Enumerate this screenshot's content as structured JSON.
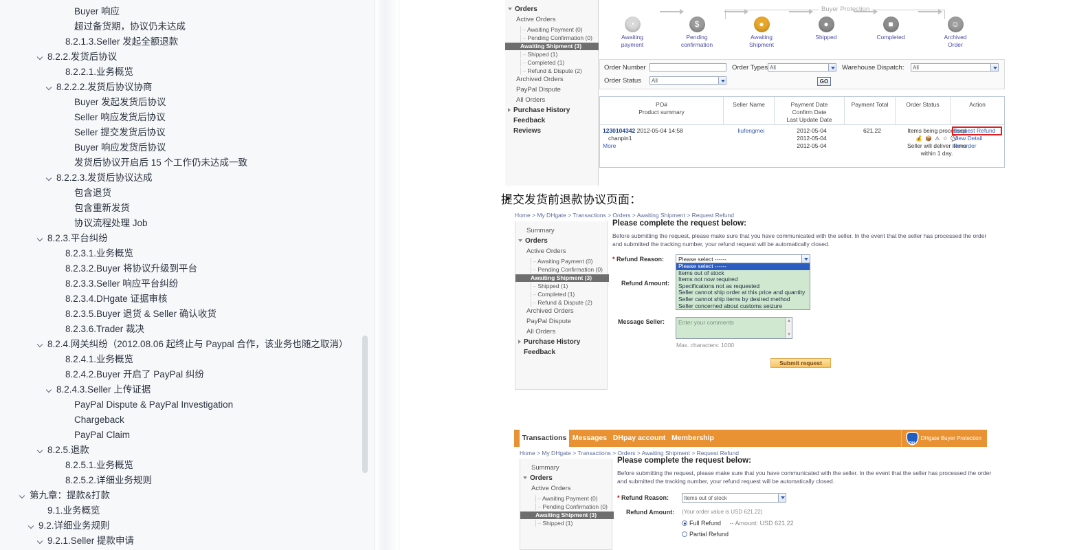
{
  "outline": {
    "items": [
      {
        "label": "Buyer 响应",
        "indent": 6,
        "caret": false
      },
      {
        "label": "超过备货期，协议仍未达成",
        "indent": 6,
        "caret": false
      },
      {
        "label": "8.2.1.3.Seller 发起全额退款",
        "indent": 5,
        "caret": false
      },
      {
        "label": "8.2.2.发货后协议",
        "indent": 3,
        "caret": true
      },
      {
        "label": "8.2.2.1.业务概览",
        "indent": 5,
        "caret": false
      },
      {
        "label": "8.2.2.2.发货后协议协商",
        "indent": 4,
        "caret": true
      },
      {
        "label": "Buyer 发起发货后协议",
        "indent": 6,
        "caret": false
      },
      {
        "label": "Seller 响应发货后协议",
        "indent": 6,
        "caret": false
      },
      {
        "label": "Seller 提交发货后协议",
        "indent": 6,
        "caret": false
      },
      {
        "label": "Buyer 响应发货后协议",
        "indent": 6,
        "caret": false
      },
      {
        "label": "发货后协议开启后 15 个工作仍未达成一致",
        "indent": 6,
        "caret": false
      },
      {
        "label": "8.2.2.3.发货后协议达成",
        "indent": 4,
        "caret": true
      },
      {
        "label": "包含退货",
        "indent": 6,
        "caret": false
      },
      {
        "label": "包含重新发货",
        "indent": 6,
        "caret": false
      },
      {
        "label": "协议流程处理 Job",
        "indent": 6,
        "caret": false
      },
      {
        "label": "8.2.3.平台纠纷",
        "indent": 3,
        "caret": true
      },
      {
        "label": "8.2.3.1.业务概览",
        "indent": 5,
        "caret": false
      },
      {
        "label": "8.2.3.2.Buyer 将协议升级到平台",
        "indent": 5,
        "caret": false
      },
      {
        "label": "8.2.3.3.Seller 响应平台纠纷",
        "indent": 5,
        "caret": false
      },
      {
        "label": "8.2.3.4.DHgate 证据审核",
        "indent": 5,
        "caret": false
      },
      {
        "label": "8.2.3.5.Buyer 退货 & Seller 确认收货",
        "indent": 5,
        "caret": false
      },
      {
        "label": "8.2.3.6.Trader 裁决",
        "indent": 5,
        "caret": false
      },
      {
        "label": "8.2.4.网关纠纷（2012.08.06 起终止与 Paypal 合作，该业务也随之取消）",
        "indent": 3,
        "caret": true
      },
      {
        "label": "8.2.4.1.业务概览",
        "indent": 5,
        "caret": false
      },
      {
        "label": "8.2.4.2.Buyer 开启了 PayPal 纠纷",
        "indent": 5,
        "caret": false
      },
      {
        "label": "8.2.4.3.Seller 上传证据",
        "indent": 4,
        "caret": true
      },
      {
        "label": "PayPal Dispute & PayPal Investigation",
        "indent": 6,
        "caret": false
      },
      {
        "label": "Chargeback",
        "indent": 6,
        "caret": false
      },
      {
        "label": "PayPal Claim",
        "indent": 6,
        "caret": false
      },
      {
        "label": "8.2.5.退款",
        "indent": 3,
        "caret": true
      },
      {
        "label": "8.2.5.1.业务概览",
        "indent": 5,
        "caret": false
      },
      {
        "label": "8.2.5.2.详细业务规则",
        "indent": 5,
        "caret": false
      },
      {
        "label": "第九章：提款&打款",
        "indent": 1,
        "caret": true
      },
      {
        "label": "9.1.业务概览",
        "indent": 3,
        "caret": false
      },
      {
        "label": "9.2.详细业务规则",
        "indent": 2,
        "caret": true
      },
      {
        "label": "9.2.1.Seller 提款申请",
        "indent": 3,
        "caret": true
      }
    ]
  },
  "section_heading": {
    "arrow": "➤",
    "title": "提交发货前退款协议页面："
  },
  "orders_screenshot": {
    "sidebar": {
      "groups": [
        {
          "label": "Orders",
          "type": "group"
        },
        {
          "label": "Active Orders",
          "type": "sub"
        },
        {
          "label": "Awaiting Payment (0)",
          "type": "leaf"
        },
        {
          "label": "Pending Confirmation (0)",
          "type": "leaf"
        },
        {
          "label": "Awaiting Shipment (3)",
          "type": "active"
        },
        {
          "label": "Shipped (1)",
          "type": "leaf"
        },
        {
          "label": "Completed (1)",
          "type": "leaf"
        },
        {
          "label": "Refund & Dispute (2)",
          "type": "leaf"
        },
        {
          "label": "Archived Orders",
          "type": "sub"
        },
        {
          "label": "PayPal Dispute",
          "type": "sub"
        },
        {
          "label": "All Orders",
          "type": "sub"
        },
        {
          "label": "Purchase History",
          "type": "group"
        },
        {
          "label": "Feedback",
          "type": "group"
        },
        {
          "label": "Reviews",
          "type": "group"
        }
      ]
    },
    "flow": {
      "buyer_protection_label": "Buyer Protection",
      "steps": [
        {
          "line1": "Awaiting",
          "line2": "payment",
          "icon": "clock-icon",
          "color": "#d8d8d8"
        },
        {
          "line1": "Pending",
          "line2": "confirmation",
          "icon": "dollar-icon",
          "color": "#9b9b9b"
        },
        {
          "line1": "Awaiting",
          "line2": "Shipment",
          "icon": "package-pay-icon",
          "color": "#e8a72b"
        },
        {
          "line1": "Shipped",
          "line2": "",
          "icon": "shipped-icon",
          "color": "#8e8e8e"
        },
        {
          "line1": "Completed",
          "line2": "",
          "icon": "box-icon",
          "color": "#8e8e8e"
        },
        {
          "line1": "Archived",
          "line2": "Order",
          "icon": "smile-icon",
          "color": "#9c9c9c"
        }
      ]
    },
    "filters": {
      "order_number_label": "Order Number",
      "order_number_value": "",
      "order_types_label": "Order Types:",
      "order_types_value": "All",
      "warehouse_label": "Warehouse Dispatch:",
      "warehouse_value": "All",
      "order_status_label": "Order Status",
      "order_status_value": "All",
      "go_label": "GO"
    },
    "table": {
      "headers": [
        {
          "line1": "PO#",
          "line2": "Product summary",
          "line3": ""
        },
        {
          "line1": "Seller Name",
          "line2": "",
          "line3": ""
        },
        {
          "line1": "Payment Date",
          "line2": "Confirm Date",
          "line3": "Last Update Date"
        },
        {
          "line1": "Payment Total",
          "line2": "",
          "line3": ""
        },
        {
          "line1": "Order Status",
          "line2": "",
          "line3": ""
        },
        {
          "line1": "Action",
          "line2": "",
          "line3": ""
        }
      ],
      "row": {
        "po_number": "1230104342",
        "po_date": "2012-05-04 14:58",
        "product": "chanpin1",
        "more": "More",
        "seller": "liufengmei",
        "payment_date": "2012-05-04",
        "confirm_date": "2012-05-04",
        "last_update_date": "2012-05-04",
        "payment_total": "621.22",
        "status_line1": "Items being processed",
        "status_icons": "💰 📦 ⚠ ☆ 💬",
        "status_line2": "Seller will deliver items",
        "status_line3": "within 1 day.",
        "actions": [
          "Request Refund",
          "View Detail",
          "Re-order"
        ]
      }
    }
  },
  "refund_screenshot": {
    "breadcrumb": "Home > My DHgate > Transactions > Orders > Awaiting Shipment > Request Refund",
    "sidebar": [
      {
        "label": "Summary",
        "type": "sub"
      },
      {
        "label": "Orders",
        "type": "group"
      },
      {
        "label": "Active Orders",
        "type": "sub"
      },
      {
        "label": "Awaiting Payment (0)",
        "type": "leaf"
      },
      {
        "label": "Pending Confirmation (0)",
        "type": "leaf"
      },
      {
        "label": "Awaiting Shipment (3)",
        "type": "active"
      },
      {
        "label": "Shipped (1)",
        "type": "leaf"
      },
      {
        "label": "Completed (1)",
        "type": "leaf"
      },
      {
        "label": "Refund & Dispute (2)",
        "type": "leaf"
      },
      {
        "label": "Archived Orders",
        "type": "sub"
      },
      {
        "label": "PayPal Dispute",
        "type": "sub"
      },
      {
        "label": "All Orders",
        "type": "sub"
      },
      {
        "label": "Purchase History",
        "type": "group"
      },
      {
        "label": "Feedback",
        "type": "group"
      }
    ],
    "heading": "Please complete the request below:",
    "intro": "Before submitting the request, please make sure that you have communicated with the seller. In the event that the seller has processed the order and submitted the tracking number, your refund request will be automatically closed.",
    "refund_reason_label": "Refund Reason:",
    "refund_reason_value": "Please select ------",
    "refund_reason_options": [
      "Please select ------",
      "Items out of stock",
      "Items not now required",
      "Specifications not as requested",
      "Seller cannot ship order at this price and quantity",
      "Seller cannot ship items by desired method",
      "Seller concerned about customs seizure"
    ],
    "refund_amount_label": "Refund Amount:",
    "message_seller_label": "Message Seller:",
    "message_placeholder": "Enter your comments",
    "max_characters": "Max. characters: 1000",
    "submit_label": "Submit request"
  },
  "tabs_screenshot": {
    "tabs": [
      {
        "label": "Transactions",
        "active": true
      },
      {
        "label": "Messages",
        "active": false
      },
      {
        "label": "DHpay account",
        "active": false
      },
      {
        "label": "Membership",
        "active": false
      }
    ],
    "buyer_protection_badge": "DHgate Buyer Protection",
    "breadcrumb": "Home > My DHgate > Transactions > Orders > Awaiting Shipment > Request Refund",
    "sidebar": [
      {
        "label": "Summary",
        "type": "sub"
      },
      {
        "label": "Orders",
        "type": "group"
      },
      {
        "label": "Active Orders",
        "type": "sub"
      },
      {
        "label": "Awaiting Payment (0)",
        "type": "leaf"
      },
      {
        "label": "Pending Confirmation (0)",
        "type": "leaf"
      },
      {
        "label": "Awaiting Shipment (3)",
        "type": "active"
      },
      {
        "label": "Shipped (1)",
        "type": "leaf"
      }
    ],
    "heading": "Please complete the request below:",
    "intro": "Before submitting the request, please make sure that you have communicated with the seller. In the event that the seller has processed the order and submitted the tracking number, your refund request will be automatically closed.",
    "refund_reason_label": "Refund Reason:",
    "refund_reason_value": "Items out of stock",
    "refund_amount_label": "Refund Amount:",
    "order_value_note": "(Your order value is USD 621.22)",
    "full_refund_label": "Full Refund",
    "full_refund_amount": "-- Amount: USD 621.22",
    "partial_refund_label": "Partial Refund"
  },
  "colors": {
    "brand_orange": "#e99234",
    "active_gray": "#6e6e6e",
    "highlight_red": "#e31c1c",
    "select_blue": "#2c5cbf",
    "option_green": "#cfe8cf"
  }
}
